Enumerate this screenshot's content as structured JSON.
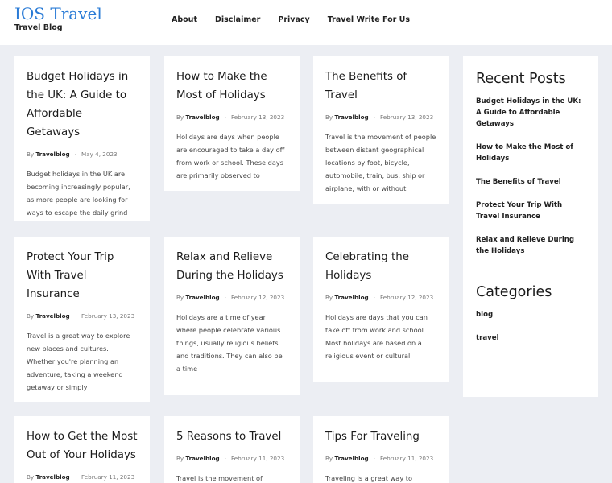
{
  "site": {
    "title": "IOS Travel",
    "tagline": "Travel Blog"
  },
  "nav": [
    {
      "label": "About"
    },
    {
      "label": "Disclaimer"
    },
    {
      "label": "Privacy"
    },
    {
      "label": "Travel Write For Us"
    }
  ],
  "posts": [
    {
      "title": "Budget Holidays in the UK: A Guide to Affordable Getaways",
      "author": "Travelblog",
      "date": "May 4, 2023",
      "excerpt": "Budget holidays in the UK are becoming increasingly popular, as more people are looking for ways to escape the daily grind without"
    },
    {
      "title": "How to Make the Most of Holidays",
      "author": "Travelblog",
      "date": "February 13, 2023",
      "excerpt": "Holidays are days when people are encouraged to take a day off from work or school. These days are primarily observed to"
    },
    {
      "title": "The Benefits of Travel",
      "author": "Travelblog",
      "date": "February 13, 2023",
      "excerpt": "Travel is the movement of people between distant geographical locations by foot, bicycle, automobile, train, bus, ship or airplane, with or without"
    },
    {
      "title": "Protect Your Trip With Travel Insurance",
      "author": "Travelblog",
      "date": "February 13, 2023",
      "excerpt": "Travel is a great way to explore new places and cultures. Whether you're planning an adventure, taking a weekend getaway or simply"
    },
    {
      "title": "Relax and Relieve During the Holidays",
      "author": "Travelblog",
      "date": "February 12, 2023",
      "excerpt": "Holidays are a time of year where people celebrate various things, usually religious beliefs and traditions. They can also be a time"
    },
    {
      "title": "Celebrating the Holidays",
      "author": "Travelblog",
      "date": "February 12, 2023",
      "excerpt": "Holidays are days that you can take off from work and school. Most holidays are based on a religious event or cultural"
    },
    {
      "title": "How to Get the Most Out of Your Holidays",
      "author": "Travelblog",
      "date": "February 11, 2023",
      "excerpt": ""
    },
    {
      "title": "5 Reasons to Travel",
      "author": "Travelblog",
      "date": "February 11, 2023",
      "excerpt": "Travel is the movement of"
    },
    {
      "title": "Tips For Traveling",
      "author": "Travelblog",
      "date": "February 11, 2023",
      "excerpt": "Traveling is a great way to"
    }
  ],
  "sidebar": {
    "recent_heading": "Recent Posts",
    "recent": [
      {
        "label": "Budget Holidays in the UK: A Guide to Affordable Getaways"
      },
      {
        "label": "How to Make the Most of Holidays"
      },
      {
        "label": "The Benefits of Travel"
      },
      {
        "label": "Protect Your Trip With Travel Insurance"
      },
      {
        "label": "Relax and Relieve During the Holidays"
      }
    ],
    "categories_heading": "Categories",
    "categories": [
      {
        "label": "blog"
      },
      {
        "label": "travel"
      }
    ]
  },
  "colors": {
    "accent": "#2a7bd6",
    "background": "#eceef3",
    "card": "#ffffff"
  }
}
